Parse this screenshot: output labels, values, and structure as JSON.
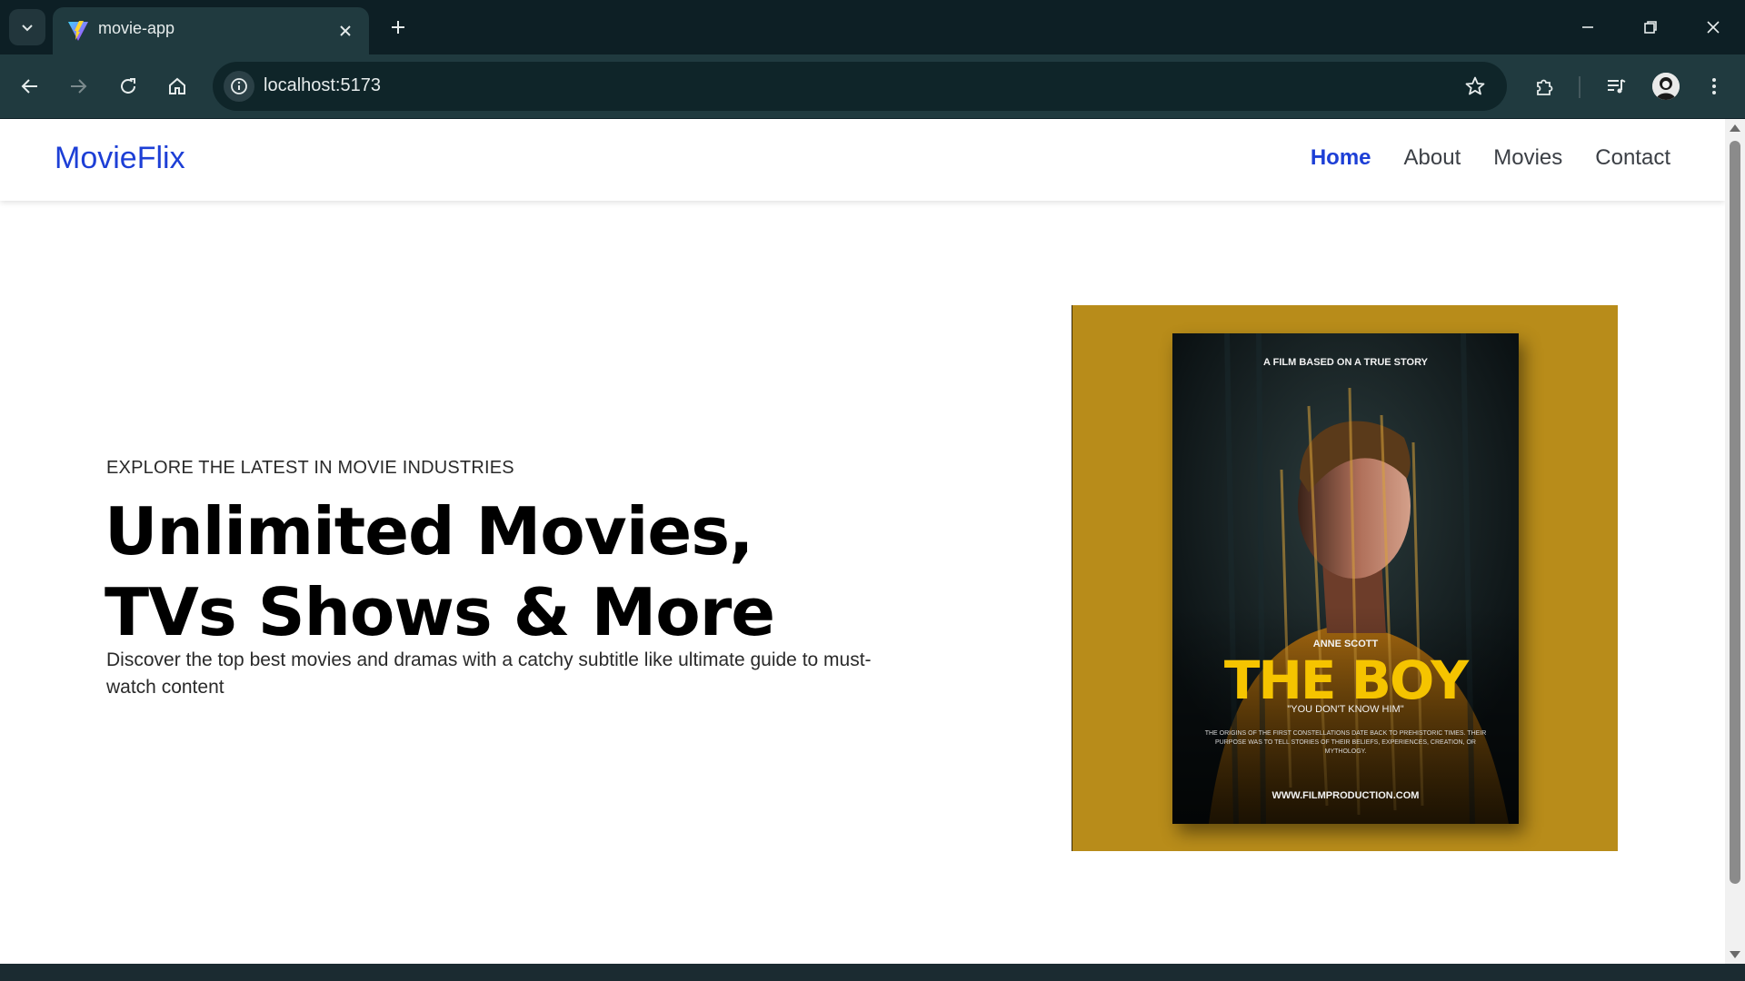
{
  "browser": {
    "tab_title": "movie-app",
    "url": "localhost:5173"
  },
  "navbar": {
    "brand": "MovieFlix",
    "links": [
      {
        "label": "Home",
        "active": true
      },
      {
        "label": "About",
        "active": false
      },
      {
        "label": "Movies",
        "active": false
      },
      {
        "label": "Contact",
        "active": false
      }
    ]
  },
  "hero": {
    "eyebrow": "EXPLORE THE LATEST IN MOVIE INDUSTRIES",
    "title": "Unlimited Movies, TVs Shows & More",
    "subtitle": "Discover the top best movies and dramas with a catchy subtitle like ultimate guide to must-watch content"
  },
  "poster": {
    "tagline": "A FILM BASED ON A TRUE STORY",
    "actor": "ANNE SCOTT",
    "title": "THE BOY",
    "quote": "\"YOU DON'T KNOW HIM\"",
    "blurb": "THE ORIGINS OF THE FIRST CONSTELLATIONS DATE BACK TO PREHISTORIC TIMES. THEIR PURPOSE WAS TO TELL STORIES OF THEIR BELIEFS, EXPERIENCES, CREATION, OR MYTHOLOGY.",
    "url": "WWW.FILMPRODUCTION.COM"
  },
  "colors": {
    "brand": "#1d3fd6",
    "poster_background": "#b88c1a",
    "poster_title": "#f5c400",
    "chrome_dark": "#0d1f25",
    "chrome_toolbar": "#203a3f"
  }
}
